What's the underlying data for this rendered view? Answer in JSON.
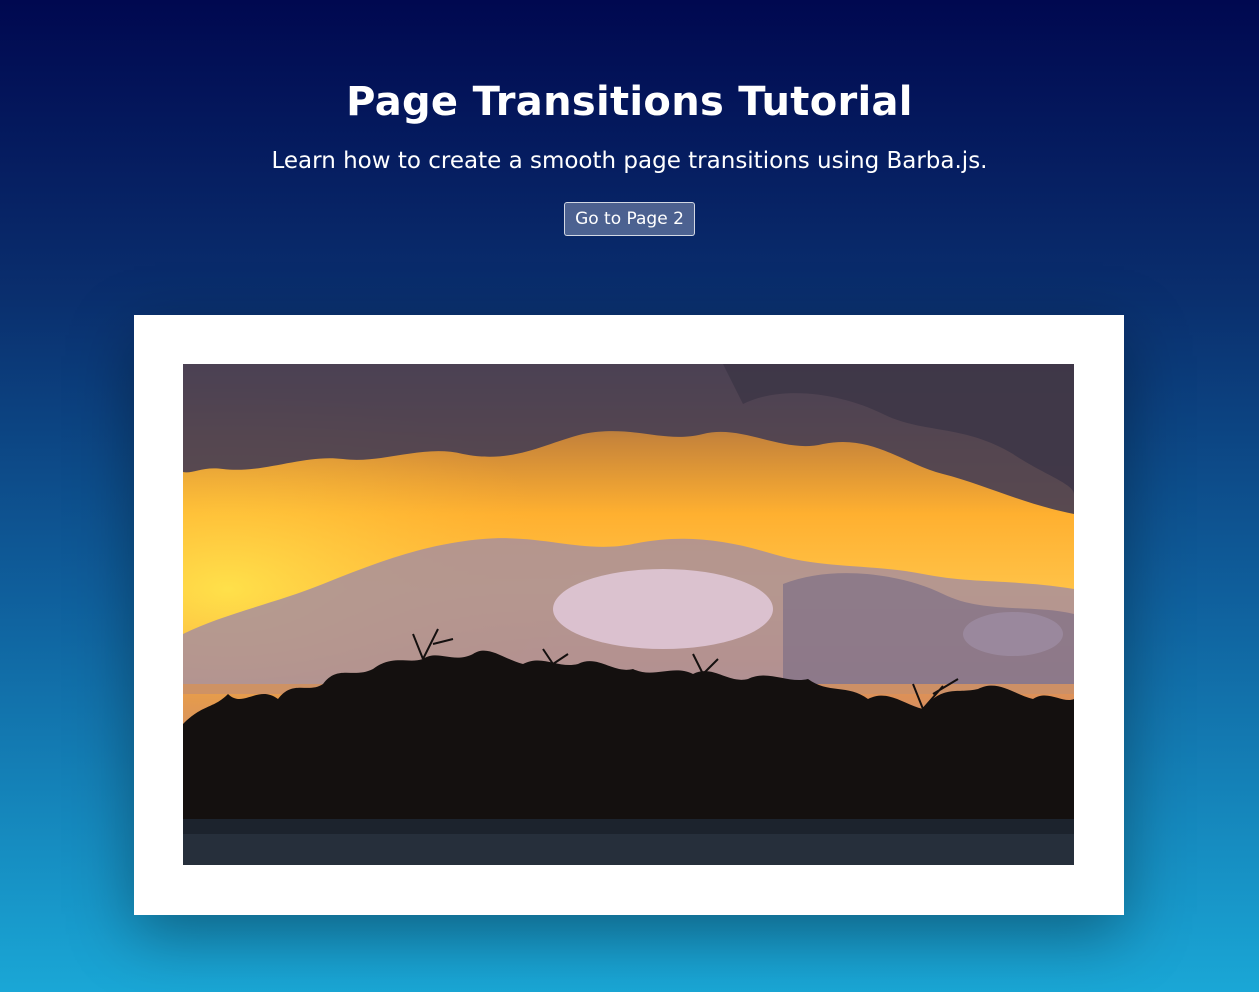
{
  "header": {
    "title": "Page Transitions Tutorial",
    "subtitle": "Learn how to create a smooth page transitions using Barba.js.",
    "button_label": "Go to Page 2"
  },
  "image": {
    "description_icon": "sunset-landscape-photo"
  },
  "colors": {
    "gradient_top": "#000850",
    "gradient_bottom": "#1aa7d6",
    "card": "#ffffff"
  }
}
